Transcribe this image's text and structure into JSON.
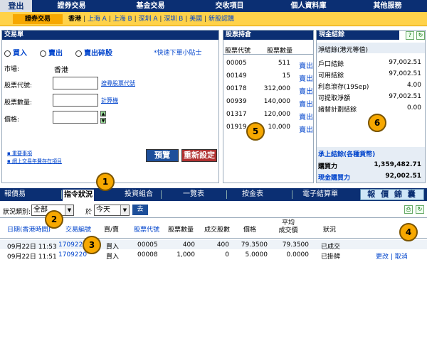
{
  "top_nav": {
    "logout": "登出",
    "items": [
      "證券交易",
      "基金交易",
      "交收項目",
      "個人資料庫",
      "其他服務"
    ]
  },
  "sub_nav": {
    "section": "證券交易",
    "current_market": "香港",
    "links": [
      "上海 A",
      "上海 B",
      "深圳 A",
      "深圳 B",
      "美國",
      "新股認購"
    ]
  },
  "order_form": {
    "header": "交易單",
    "buy": "買入",
    "sell": "賣出",
    "sell_odd": "賣出碎股",
    "quick_tips": "*快速下單小貼士",
    "market_label": "市場:",
    "market_value": "香港",
    "stock_code_label": "股票代號:",
    "search_code": "搜尋股票代號",
    "quantity_label": "股票數量:",
    "calculator": "計算機",
    "price_label": "價格:",
    "links": [
      "重要事項",
      "網上交易年費存在項目"
    ],
    "preview": "預覽",
    "reset": "重新設定"
  },
  "holdings": {
    "header": "股票持倉",
    "col_code": "股票代號",
    "col_qty": "股票數量",
    "rows": [
      {
        "code": "00005",
        "qty": "511",
        "action": "賣出"
      },
      {
        "code": "00149",
        "qty": "15",
        "action": "賣出"
      },
      {
        "code": "00178",
        "qty": "312,000",
        "action": "賣出"
      },
      {
        "code": "00939",
        "qty": "140,000",
        "action": "賣出"
      },
      {
        "code": "01317",
        "qty": "120,000",
        "action": "賣出"
      },
      {
        "code": "01919",
        "qty": "10,000",
        "action": "賣出"
      }
    ]
  },
  "cash": {
    "header": "現金結餘",
    "subheader": "淨結餘(港元等值)",
    "rows": [
      {
        "label": "戶口結餘",
        "value": "97,002.51"
      },
      {
        "label": "可用結餘",
        "value": "97,002.51"
      },
      {
        "label": "利息滾存(19Sep)",
        "value": "4.00"
      },
      {
        "label": "可提取淨額",
        "value": "97,002.51"
      },
      {
        "label": "諸替計劃結餘",
        "value": "0.00"
      }
    ],
    "section2_title": "承上結餘(各種貨幣)",
    "buying_power_label": "購買力",
    "buying_power_value": "1,359,482.71",
    "cash_power_label": "現金購買力",
    "cash_power_value": "92,002.51"
  },
  "tabs": {
    "items": [
      "報價易",
      "指令狀況",
      "投資組合",
      "一覽表",
      "按金表",
      "電子結算單"
    ],
    "active": "指令狀況",
    "report_button": "報 價 錦 囊"
  },
  "filter": {
    "status_label": "狀況類別:",
    "status_value": "全部",
    "in_label": "於",
    "date_value": "今天",
    "go": "去"
  },
  "orders_table": {
    "headers": [
      "日期(香港時間)",
      "交易編號",
      "買/賣",
      "股票代號",
      "股票數量",
      "成交股數",
      "價格",
      "平均\n成交價",
      "狀況"
    ],
    "rows": [
      {
        "date": "09月22日 11:53",
        "id": "1709220",
        "side": "買入",
        "code": "00005",
        "qty": "400",
        "filled": "400",
        "price": "79.3500",
        "avg": "79.3500",
        "status": "已成交",
        "actions": ""
      },
      {
        "date": "09月22日 11:51",
        "id": "1709220",
        "side": "買入",
        "code": "00008",
        "qty": "1,000",
        "filled": "0",
        "price": "5.0000",
        "avg": "0.0000",
        "status": "已掛牌",
        "actions": "更改 | 取消"
      }
    ]
  },
  "callouts": [
    "1",
    "2",
    "3",
    "4",
    "5",
    "6"
  ]
}
